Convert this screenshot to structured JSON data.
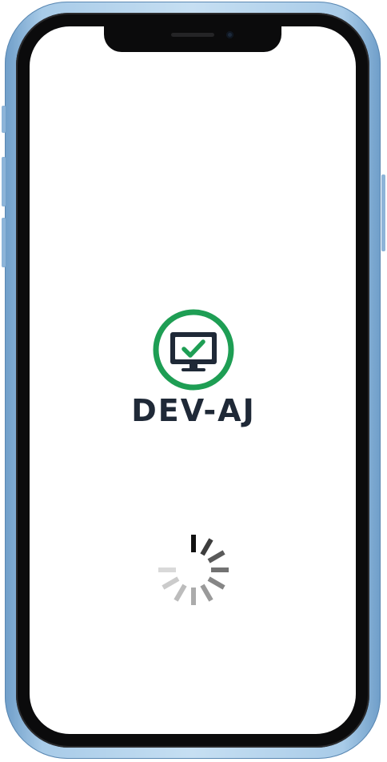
{
  "device": {
    "model": "iPhone",
    "frame_color": "#a8cbe8"
  },
  "screen": {
    "background": "#ffffff"
  },
  "logo": {
    "icon": "monitor-check-icon",
    "text": "DEV-AJ",
    "ring_color": "#1e9e54",
    "icon_color": "#1f2937",
    "check_color": "#1e9e54"
  },
  "loader": {
    "icon": "loading-spinner-icon"
  }
}
